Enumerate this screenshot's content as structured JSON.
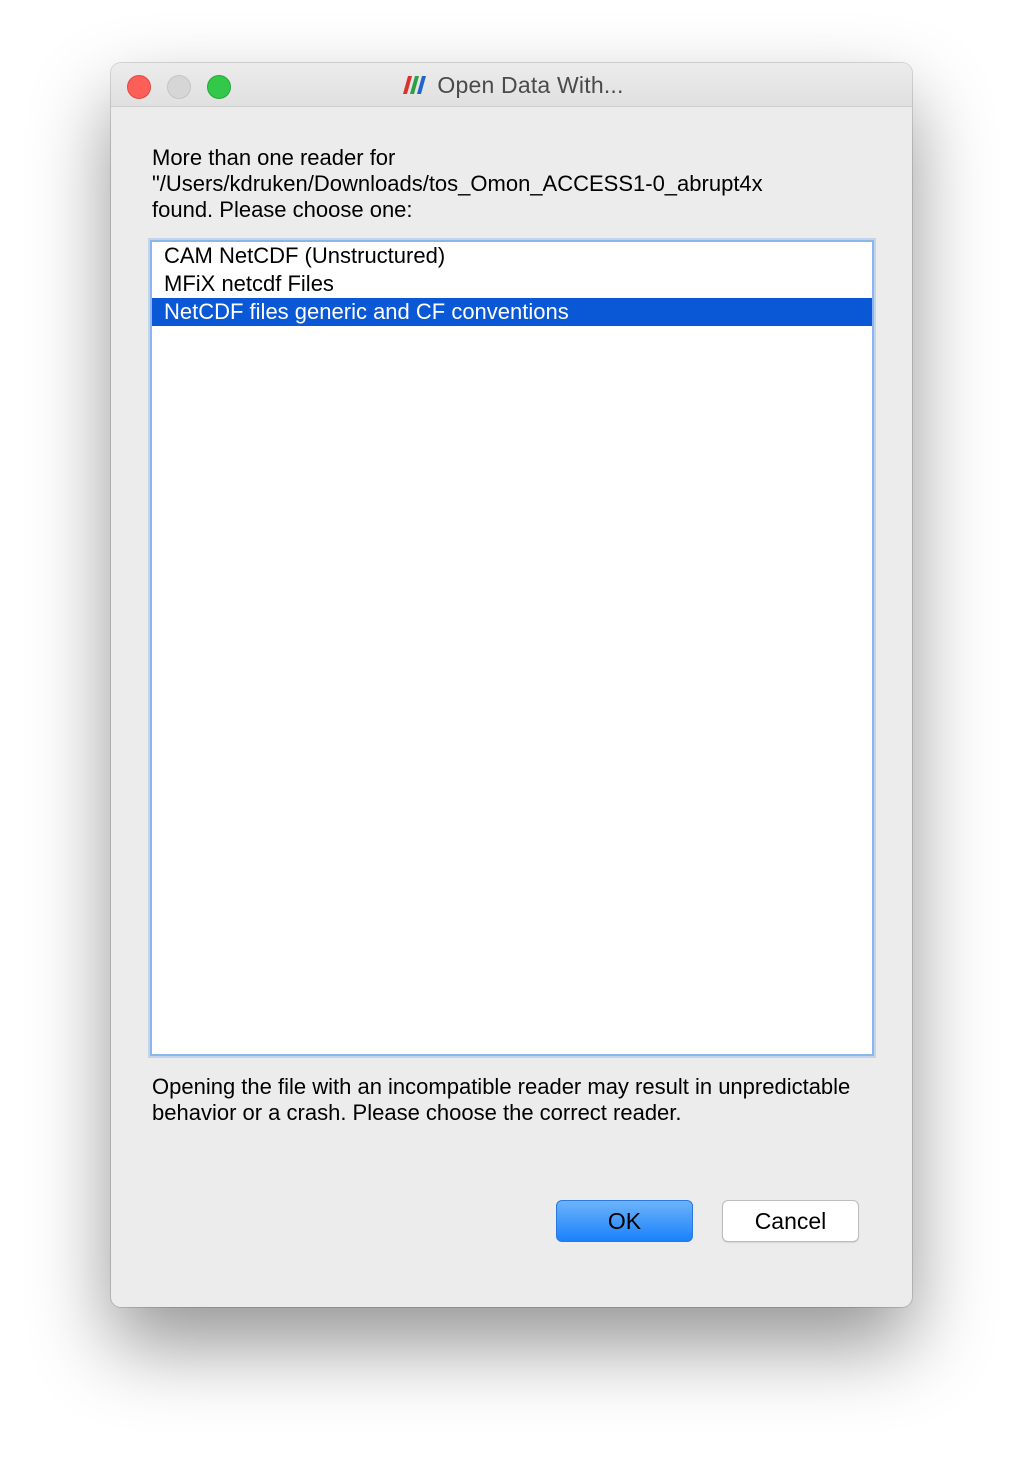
{
  "window": {
    "title": "Open Data With...",
    "app_icon": "paraview-logo-icon"
  },
  "traffic_lights": {
    "close": "close-icon",
    "minimize": "minimize-icon",
    "zoom": "zoom-icon"
  },
  "dialog": {
    "intro_text": "More than one reader for\n\"/Users/kdruken/Downloads/tos_Omon_ACCESS1-0_abrupt4x\nfound.  Please choose one:",
    "readers": [
      {
        "label": "CAM NetCDF (Unstructured)",
        "selected": false
      },
      {
        "label": "MFiX netcdf Files",
        "selected": false
      },
      {
        "label": "NetCDF files generic and CF conventions",
        "selected": true
      }
    ],
    "warning_text": "Opening the file with an incompatible reader may result in unpredictable behavior or a crash.  Please choose the correct reader.",
    "ok_label": "OK",
    "cancel_label": "Cancel"
  },
  "colors": {
    "selection": "#0b58d6",
    "ok_button": "#1a82fb",
    "close": "#fc5f57",
    "zoom": "#34c84a"
  }
}
